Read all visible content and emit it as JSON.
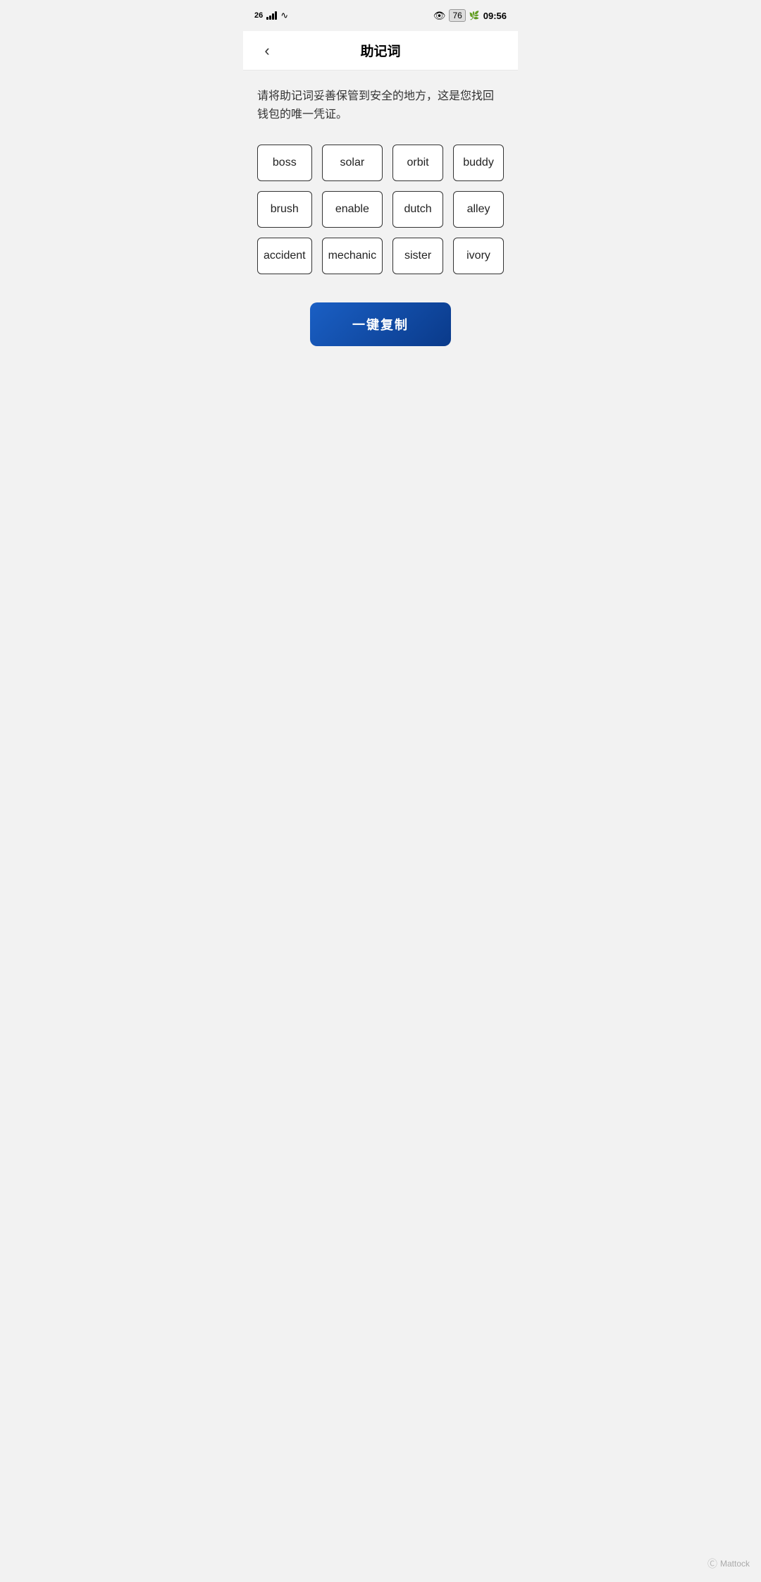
{
  "statusBar": {
    "carrier": "26",
    "time": "09:56",
    "battery": "76"
  },
  "header": {
    "title": "助记词",
    "backLabel": "‹"
  },
  "description": "请将助记词妥善保管到安全的地方，这是您找回钱包的唯一凭证。",
  "mnemonicWords": [
    "boss",
    "solar",
    "orbit",
    "buddy",
    "brush",
    "enable",
    "dutch",
    "alley",
    "accident",
    "mechanic",
    "sister",
    "ivory"
  ],
  "copyButton": {
    "label": "一键复制"
  },
  "footer": {
    "watermark": "Mattock"
  }
}
